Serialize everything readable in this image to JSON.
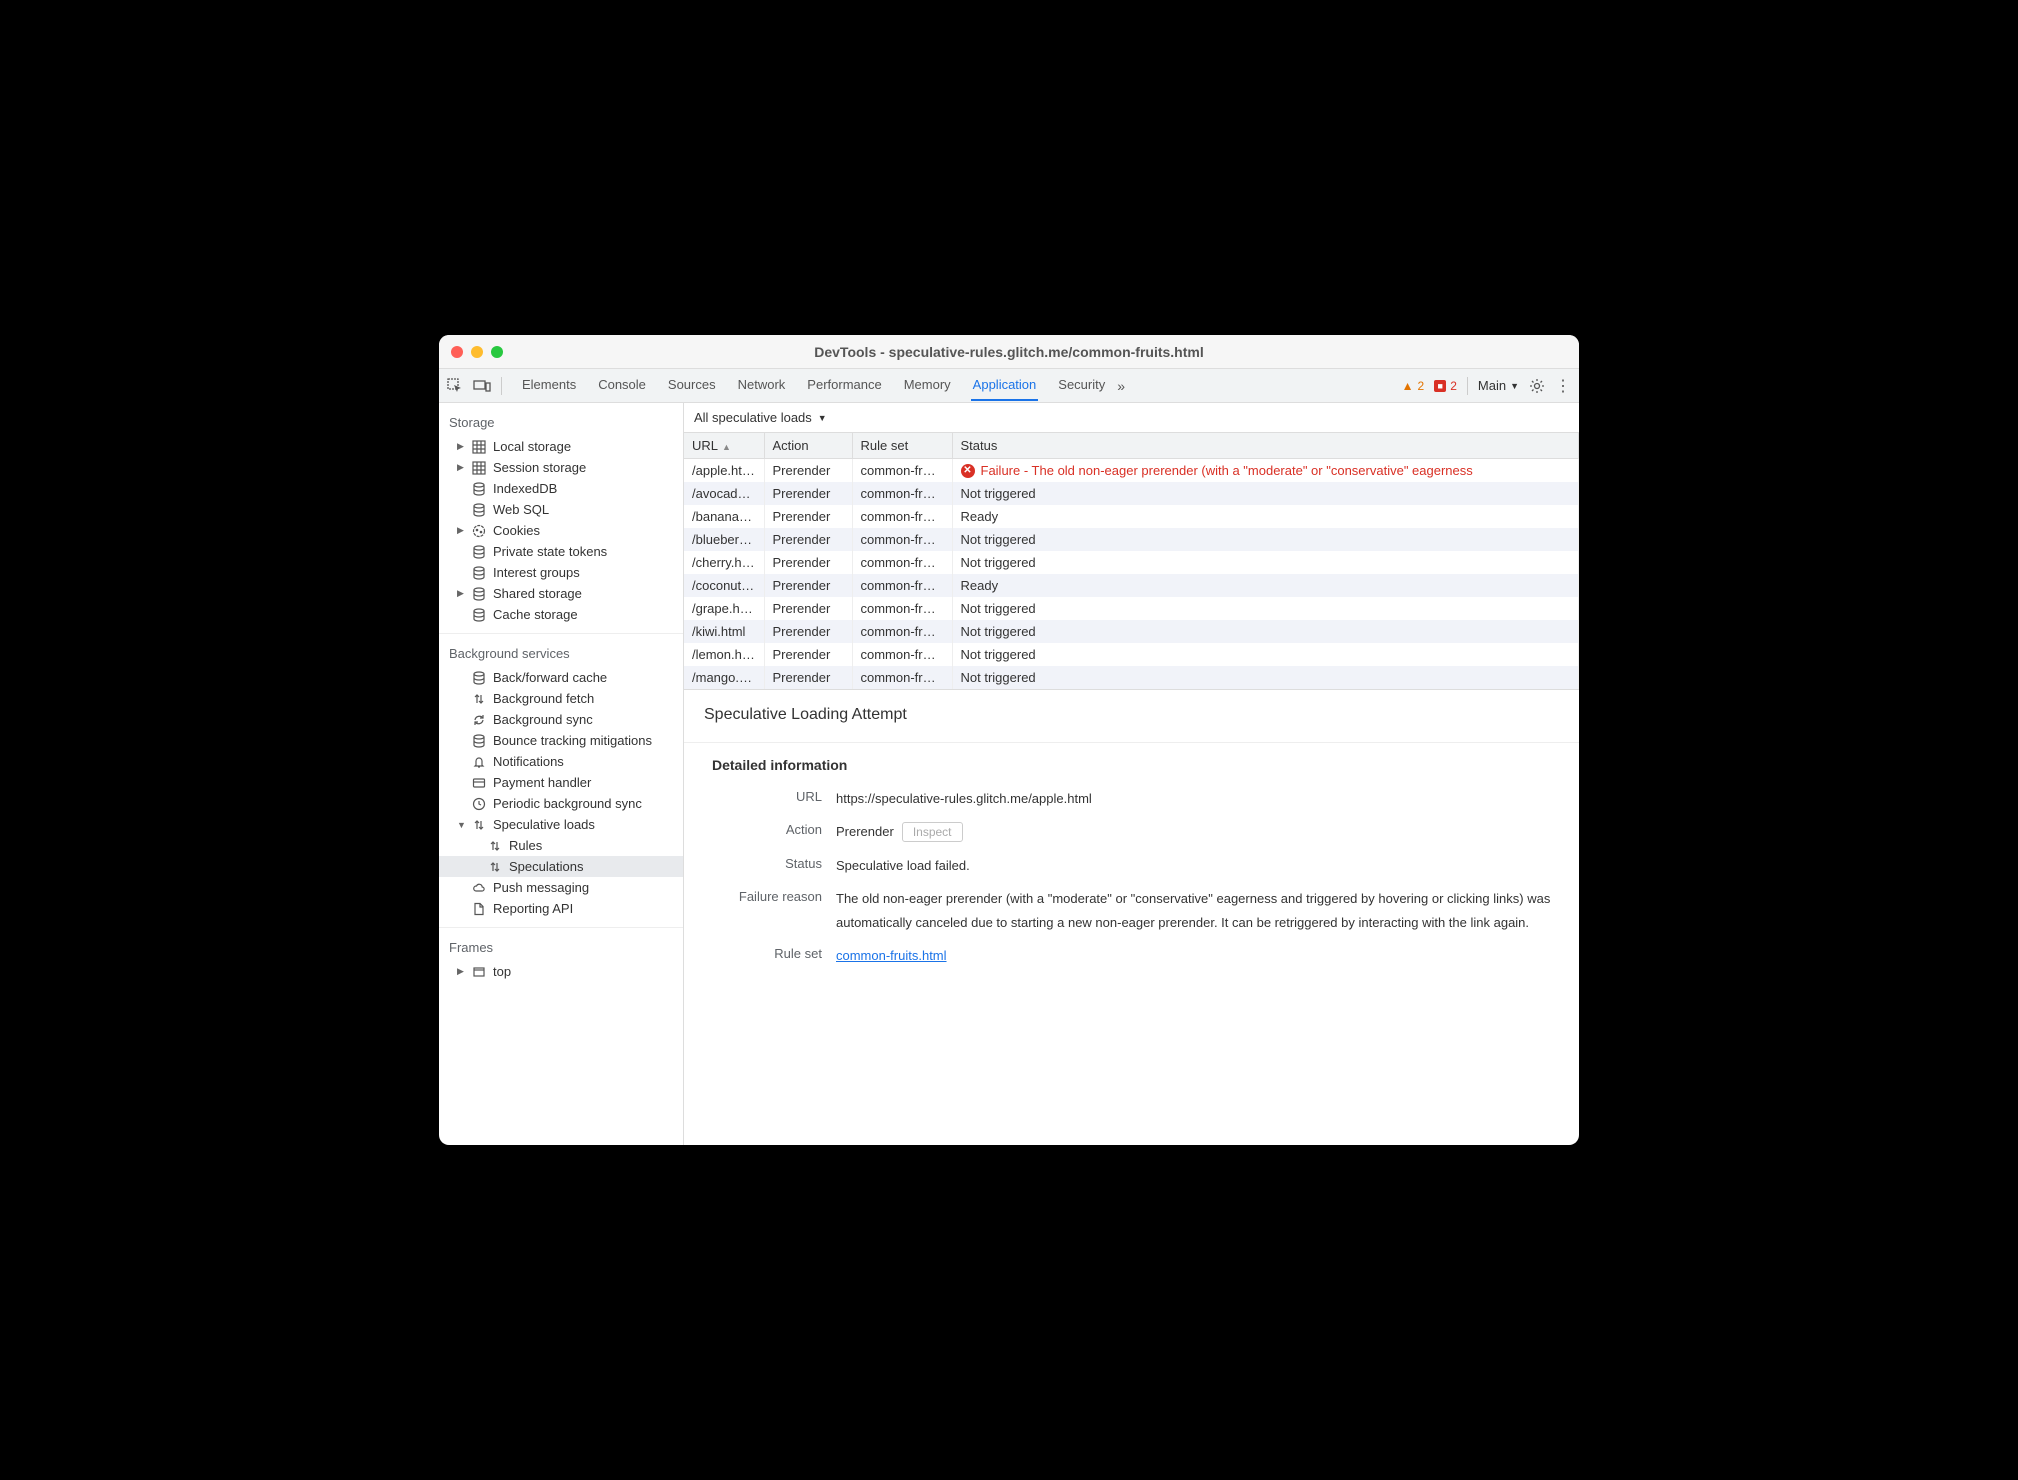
{
  "window_title": "DevTools - speculative-rules.glitch.me/common-fruits.html",
  "tabs": [
    "Elements",
    "Console",
    "Sources",
    "Network",
    "Performance",
    "Memory",
    "Application",
    "Security"
  ],
  "active_tab": "Application",
  "warnings_count": "2",
  "errors_count": "2",
  "frame_selector": "Main",
  "sidebar": {
    "storage_h": "Storage",
    "storage": [
      {
        "label": "Local storage",
        "icon": "grid",
        "exp": true
      },
      {
        "label": "Session storage",
        "icon": "grid",
        "exp": true
      },
      {
        "label": "IndexedDB",
        "icon": "db"
      },
      {
        "label": "Web SQL",
        "icon": "db"
      },
      {
        "label": "Cookies",
        "icon": "cookie",
        "exp": true
      },
      {
        "label": "Private state tokens",
        "icon": "db"
      },
      {
        "label": "Interest groups",
        "icon": "db"
      },
      {
        "label": "Shared storage",
        "icon": "db",
        "exp": true
      },
      {
        "label": "Cache storage",
        "icon": "db"
      }
    ],
    "bg_h": "Background services",
    "bg": [
      {
        "label": "Back/forward cache",
        "icon": "db"
      },
      {
        "label": "Background fetch",
        "icon": "updown"
      },
      {
        "label": "Background sync",
        "icon": "sync"
      },
      {
        "label": "Bounce tracking mitigations",
        "icon": "db"
      },
      {
        "label": "Notifications",
        "icon": "bell"
      },
      {
        "label": "Payment handler",
        "icon": "card"
      },
      {
        "label": "Periodic background sync",
        "icon": "clock"
      },
      {
        "label": "Speculative loads",
        "icon": "updown",
        "exp": true,
        "open": true
      },
      {
        "label": "Rules",
        "icon": "updown",
        "child": true
      },
      {
        "label": "Speculations",
        "icon": "updown",
        "child": true,
        "selected": true
      },
      {
        "label": "Push messaging",
        "icon": "cloud"
      },
      {
        "label": "Reporting API",
        "icon": "file"
      }
    ],
    "frames_h": "Frames",
    "frames": [
      {
        "label": "top",
        "icon": "frame",
        "exp": true
      }
    ]
  },
  "filter_label": "All speculative loads",
  "columns": [
    "URL",
    "Action",
    "Rule set",
    "Status"
  ],
  "rows": [
    {
      "url": "/apple.html",
      "action": "Prerender",
      "rule": "common-fr…",
      "status": "Failure - The old non-eager prerender (with a \"moderate\" or \"conservative\" eagerness",
      "fail": true
    },
    {
      "url": "/avocad…",
      "action": "Prerender",
      "rule": "common-fr…",
      "status": "Not triggered"
    },
    {
      "url": "/banana.…",
      "action": "Prerender",
      "rule": "common-fr…",
      "status": "Ready"
    },
    {
      "url": "/blueberr…",
      "action": "Prerender",
      "rule": "common-fr…",
      "status": "Not triggered"
    },
    {
      "url": "/cherry.h…",
      "action": "Prerender",
      "rule": "common-fr…",
      "status": "Not triggered"
    },
    {
      "url": "/coconut…",
      "action": "Prerender",
      "rule": "common-fr…",
      "status": "Ready"
    },
    {
      "url": "/grape.html",
      "action": "Prerender",
      "rule": "common-fr…",
      "status": "Not triggered"
    },
    {
      "url": "/kiwi.html",
      "action": "Prerender",
      "rule": "common-fr…",
      "status": "Not triggered"
    },
    {
      "url": "/lemon.h…",
      "action": "Prerender",
      "rule": "common-fr…",
      "status": "Not triggered"
    },
    {
      "url": "/mango.…",
      "action": "Prerender",
      "rule": "common-fr…",
      "status": "Not triggered"
    }
  ],
  "detail": {
    "title": "Speculative Loading Attempt",
    "section": "Detailed information",
    "url_k": "URL",
    "url_v": "https://speculative-rules.glitch.me/apple.html",
    "action_k": "Action",
    "action_v": "Prerender",
    "inspect": "Inspect",
    "status_k": "Status",
    "status_v": "Speculative load failed.",
    "reason_k": "Failure reason",
    "reason_v": "The old non-eager prerender (with a \"moderate\" or \"conservative\" eagerness and triggered by hovering or clicking links) was automatically canceled due to starting a new non-eager prerender. It can be retriggered by interacting with the link again.",
    "ruleset_k": "Rule set",
    "ruleset_v": "common-fruits.html"
  }
}
